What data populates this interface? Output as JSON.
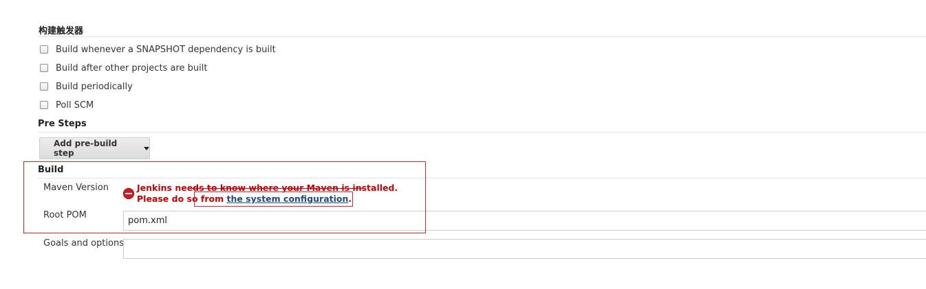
{
  "build_triggers": {
    "title": "构建触发器",
    "options": [
      {
        "label": "Build whenever a SNAPSHOT dependency is built",
        "checked": false
      },
      {
        "label": "Build after other projects are built",
        "checked": false
      },
      {
        "label": "Build periodically",
        "checked": false
      },
      {
        "label": "Poll SCM",
        "checked": false
      }
    ]
  },
  "pre_steps": {
    "title": "Pre Steps",
    "add_button_label": "Add pre-build step"
  },
  "build": {
    "title": "Build",
    "maven_version_label": "Maven Version",
    "error_line1": "Jenkins needs to know where your Maven is installed.",
    "error_line2_prefix": "Please do so from ",
    "error_link": "the system configuration",
    "error_line2_suffix": ".",
    "root_pom_label": "Root POM",
    "root_pom_value": "pom.xml",
    "goals_label": "Goals and options",
    "goals_value": ""
  },
  "colors": {
    "error": "#cc0000",
    "link": "#204a87",
    "annotation_box": "#d9262b"
  }
}
